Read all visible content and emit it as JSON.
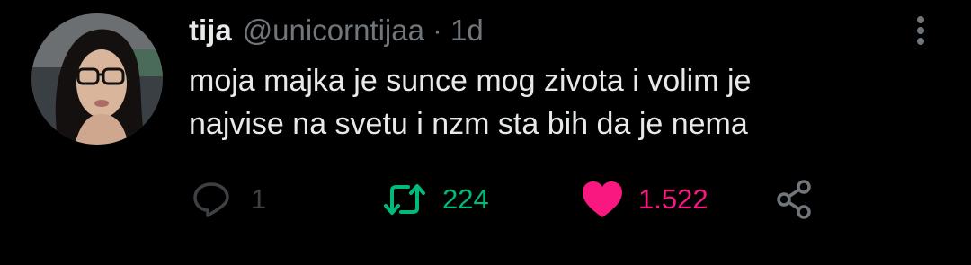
{
  "tweet": {
    "display_name": "tija",
    "handle": "@unicorntijaa",
    "separator": "·",
    "timestamp": "1d",
    "text_lines": [
      "moja majka je sunce mog zivota i volim je",
      "najvise na svetu i nzm sta bih da je nema"
    ],
    "avatar_icon": "profile-photo"
  },
  "actions": {
    "reply": {
      "icon": "reply-icon",
      "count": "1"
    },
    "retweet": {
      "icon": "retweet-icon",
      "count": "224"
    },
    "like": {
      "icon": "heart-icon",
      "count": "1.522"
    },
    "share": {
      "icon": "share-icon"
    },
    "more": {
      "icon": "more-vertical-icon"
    }
  },
  "colors": {
    "background": "#000000",
    "primary_text": "#e7e9ea",
    "secondary_text": "#71767b",
    "reply": "#3e4144",
    "retweet": "#00ba7c",
    "like": "#f91880"
  }
}
